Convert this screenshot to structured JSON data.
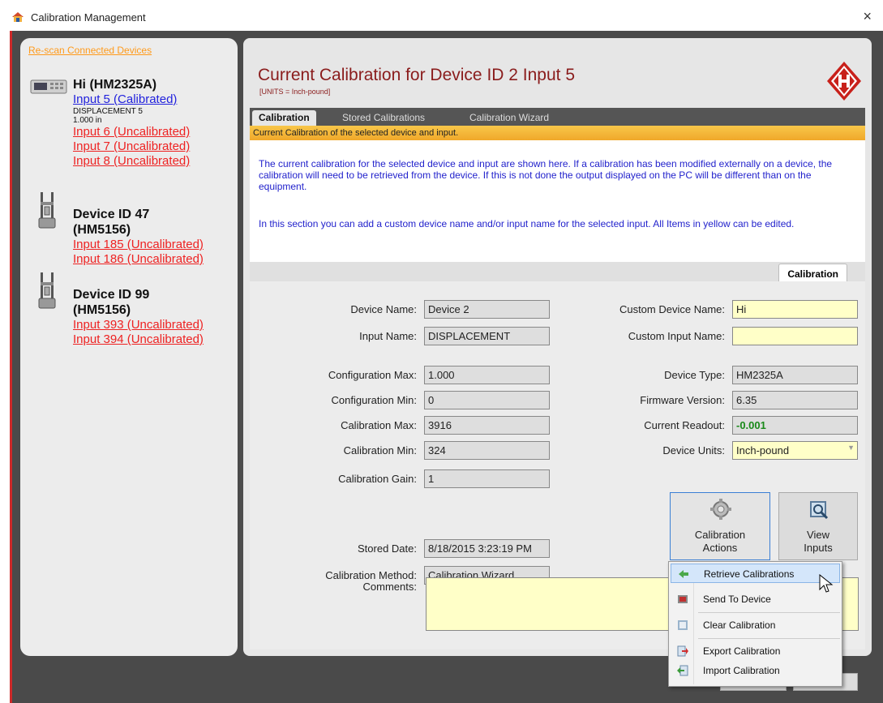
{
  "window": {
    "title": "Calibration Management",
    "close_glyph": "×"
  },
  "sidebar": {
    "rescan_label": "Re-scan Connected Devices",
    "devices": [
      {
        "name": "Hi (HM2325A)",
        "icon": "readout-device-icon",
        "inputs": [
          {
            "label": "Input 5 (Calibrated)",
            "status": "calibrated"
          },
          {
            "label": "Input 6 (Uncalibrated)",
            "status": "uncalibrated"
          },
          {
            "label": "Input 7 (Uncalibrated)",
            "status": "uncalibrated"
          },
          {
            "label": "Input 8 (Uncalibrated)",
            "status": "uncalibrated"
          }
        ],
        "selected_input_detail": {
          "line1": "DISPLACEMENT 5",
          "line2": "1.000 in"
        }
      },
      {
        "name_line1": "Device ID 47",
        "name_line2": "(HM5156)",
        "icon": "load-frame-icon",
        "inputs": [
          {
            "label": "Input 185 (Uncalibrated)",
            "status": "uncalibrated"
          },
          {
            "label": "Input 186 (Uncalibrated)",
            "status": "uncalibrated"
          }
        ]
      },
      {
        "name_line1": "Device ID 99",
        "name_line2": "(HM5156)",
        "icon": "load-frame-icon",
        "inputs": [
          {
            "label": "Input 393 (Uncalibrated)",
            "status": "uncalibrated"
          },
          {
            "label": "Input 394 (Uncalibrated)",
            "status": "uncalibrated"
          }
        ]
      }
    ]
  },
  "main": {
    "title": "Current Calibration for Device ID 2 Input 5",
    "units": "[UNITS = Inch-pound]",
    "tabs": [
      {
        "label": "Calibration",
        "active": true
      },
      {
        "label": "Stored Calibrations",
        "active": false
      },
      {
        "label": "Calibration Wizard",
        "active": false
      }
    ],
    "banner": "Current Calibration of the selected device and  input.",
    "description1": "The current calibration for the selected device and input are shown here.  If a calibration has been modified externally on a device, the calibration will need to be retrieved from the device.  If this is not done the output displayed on the PC will be different than on the equipment.",
    "description2": "In this section you can add a custom device name and/or input name for the selected input.  All Items in yellow can be edited.",
    "subtab": "Calibration"
  },
  "form": {
    "device_name": {
      "label": "Device Name:",
      "value": "Device 2"
    },
    "input_name": {
      "label": "Input Name:",
      "value": "DISPLACEMENT"
    },
    "custom_device_name": {
      "label": "Custom Device Name:",
      "value": "Hi"
    },
    "custom_input_name": {
      "label": "Custom Input Name:",
      "value": ""
    },
    "config_max": {
      "label": "Configuration Max:",
      "value": "1.000"
    },
    "config_min": {
      "label": "Configuration Min:",
      "value": "0"
    },
    "cal_max": {
      "label": "Calibration Max:",
      "value": "3916"
    },
    "cal_min": {
      "label": "Calibration Min:",
      "value": "324"
    },
    "cal_gain": {
      "label": "Calibration Gain:",
      "value": "1"
    },
    "device_type": {
      "label": "Device Type:",
      "value": "HM2325A"
    },
    "firmware": {
      "label": "Firmware Version:",
      "value": "6.35"
    },
    "current_readout": {
      "label": "Current Readout:",
      "value": "-0.001"
    },
    "device_units": {
      "label": "Device Units:",
      "value": "Inch-pound"
    },
    "stored_date": {
      "label": "Stored Date:",
      "value": "8/18/2015 3:23:19 PM"
    },
    "cal_method": {
      "label": "Calibration Method:",
      "value": "Calibration Wizard"
    },
    "comments": {
      "label": "Comments:",
      "value": ""
    }
  },
  "buttons": {
    "cal_actions": {
      "line1": "Calibration",
      "line2": "Actions",
      "icon": "gear-icon"
    },
    "view_inputs": {
      "line1": "View",
      "line2": "Inputs",
      "icon": "magnifier-icon"
    }
  },
  "context_menu": {
    "items": [
      {
        "label": "Retrieve Calibrations",
        "icon": "arrow-left-green-icon",
        "highlighted": true
      },
      {
        "label": "Send To Device",
        "icon": "send-device-icon"
      },
      {
        "label": "Clear Calibration",
        "icon": "clear-icon"
      },
      {
        "label": "Export Calibration",
        "icon": "export-icon"
      },
      {
        "label": "Import Calibration",
        "icon": "import-icon"
      }
    ]
  },
  "colors": {
    "calibrated_link": "#2222dd",
    "uncalibrated_link": "#ee2222",
    "title_red": "#8a1c1c",
    "banner_orange": "#f0a82a",
    "editable_yellow": "#ffffc8"
  }
}
